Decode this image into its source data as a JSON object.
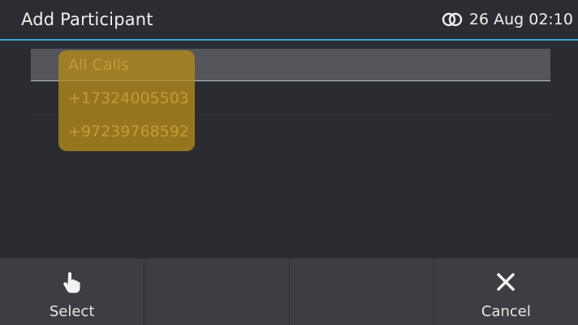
{
  "header": {
    "title": "Add Participant",
    "link_icon": "link-icon",
    "datetime": "26 Aug 02:10"
  },
  "list": {
    "items": [
      {
        "label": "All Calls",
        "selected": true
      },
      {
        "label": "+17324005503",
        "selected": false
      },
      {
        "label": "+97239768592",
        "selected": false
      }
    ]
  },
  "softkeys": [
    {
      "label": "Select",
      "icon": "hand-pointer-icon"
    },
    {
      "label": "",
      "icon": ""
    },
    {
      "label": "",
      "icon": ""
    },
    {
      "label": "Cancel",
      "icon": "close-icon"
    }
  ],
  "colors": {
    "accent": "#3aa7d6",
    "highlight": "#b08a1c",
    "background": "#2b2c31",
    "softkey_bar": "#3d3e43"
  }
}
